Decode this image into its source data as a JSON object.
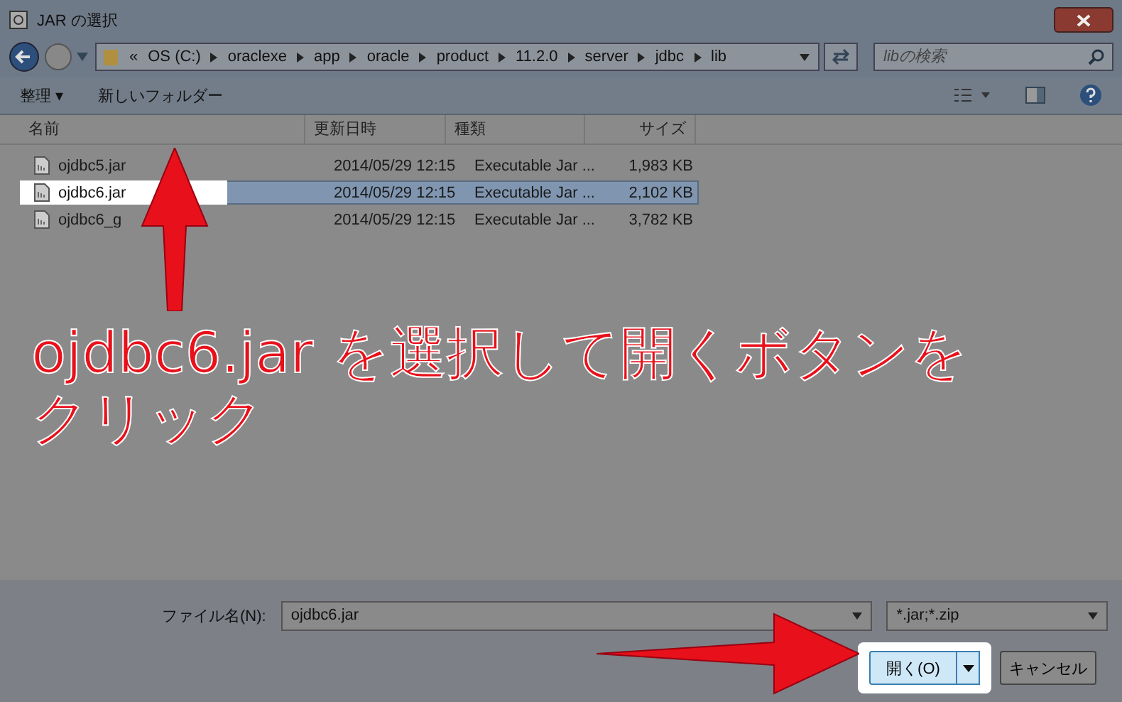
{
  "window": {
    "title": "JAR の選択"
  },
  "address": {
    "back_symbol": "«",
    "path": [
      "OS (C:)",
      "oraclexe",
      "app",
      "oracle",
      "product",
      "11.2.0",
      "server",
      "jdbc",
      "lib"
    ]
  },
  "search": {
    "placeholder": "libの検索"
  },
  "toolbar": {
    "organize": "整理 ▾",
    "new_folder": "新しいフォルダー"
  },
  "table": {
    "columns": [
      "名前",
      "更新日時",
      "種類",
      "サイズ"
    ],
    "rows": [
      {
        "name": "ojdbc5.jar",
        "modified": "2014/05/29 12:15",
        "type": "Executable Jar ...",
        "size": "1,983 KB",
        "selected": false
      },
      {
        "name": "ojdbc6.jar",
        "modified": "2014/05/29 12:15",
        "type": "Executable Jar ...",
        "size": "2,102 KB",
        "selected": true
      },
      {
        "name": "ojdbc6_g",
        "modified": "2014/05/29 12:15",
        "type": "Executable Jar ...",
        "size": "3,782 KB",
        "selected": false
      }
    ]
  },
  "filename": {
    "label": "ファイル名(N):",
    "value": "ojdbc6.jar"
  },
  "filter": {
    "value": "*.jar;*.zip"
  },
  "buttons": {
    "open": "開く(O)",
    "cancel": "キャンセル"
  },
  "annotation": {
    "text": "ojdbc6.jar を選択して開くボタンをクリック"
  }
}
